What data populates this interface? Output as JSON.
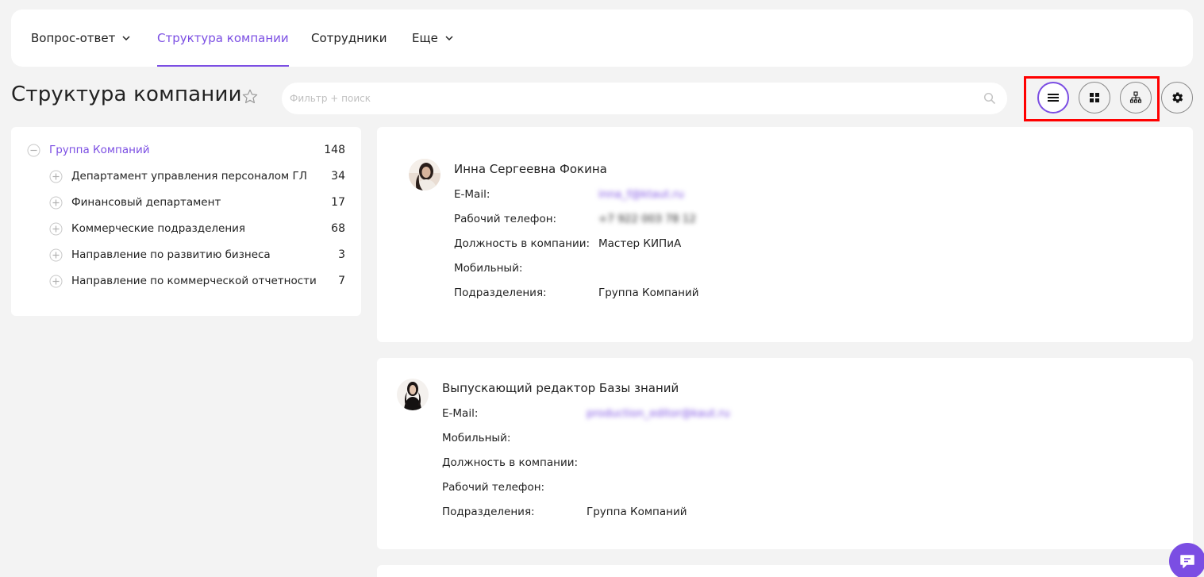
{
  "nav": {
    "items": [
      {
        "label": "Вопрос-ответ",
        "has_dropdown": true
      },
      {
        "label": "Структура компании",
        "active": true
      },
      {
        "label": "Сотрудники"
      },
      {
        "label": "Еще",
        "has_dropdown": true
      }
    ]
  },
  "page": {
    "title": "Структура компании",
    "search_placeholder": "Фильтр + поиск"
  },
  "view_toggles": [
    "list-view",
    "grid-view",
    "org-chart-view"
  ],
  "accent_color": "#7b4ee3",
  "tree": {
    "root": {
      "label": "Группа Компаний",
      "count": "148"
    },
    "children": [
      {
        "label": "Департамент управления персоналом ГЛ",
        "count": "34"
      },
      {
        "label": "Финансовый департамент",
        "count": "17"
      },
      {
        "label": "Коммерческие подразделения",
        "count": "68"
      },
      {
        "label": "Направление по развитию бизнеса",
        "count": "3"
      },
      {
        "label": "Направление по коммерческой отчетности",
        "count": "7"
      }
    ]
  },
  "employees": [
    {
      "name": "Инна Сергеевна Фокина",
      "fields": [
        {
          "label": "E-Mail:",
          "value": "inna_f@ktaut.ru",
          "blurred": true,
          "link": true
        },
        {
          "label": "Рабочий телефон:",
          "value": "+7 922 003 78 12",
          "blurred": true
        },
        {
          "label": "Должность в компании:",
          "value": "Мастер КИПиА"
        },
        {
          "label": "Мобильный:",
          "value": ""
        },
        {
          "label": "Подразделения:",
          "value": "Группа Компаний"
        }
      ]
    },
    {
      "name": "Выпускающий редактор Базы знаний",
      "fields": [
        {
          "label": "E-Mail:",
          "value": "production_editor@kaut.ru",
          "blurred": true,
          "link": true
        },
        {
          "label": "Мобильный:",
          "value": ""
        },
        {
          "label": "Должность в компании:",
          "value": ""
        },
        {
          "label": "Рабочий телефон:",
          "value": ""
        },
        {
          "label": "Подразделения:",
          "value": "Группа Компаний"
        }
      ]
    }
  ]
}
